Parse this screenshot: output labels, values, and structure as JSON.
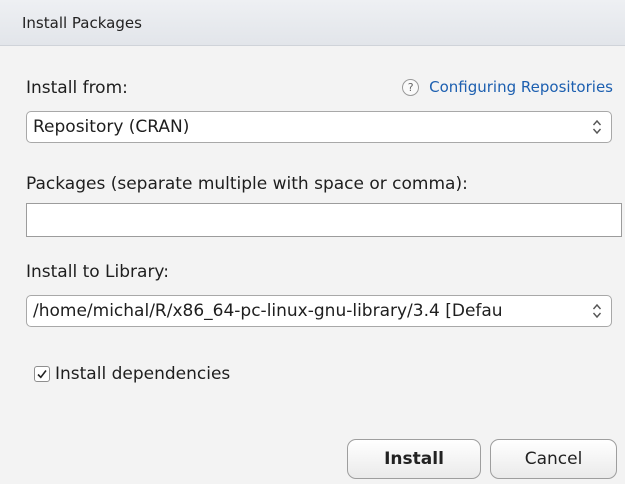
{
  "dialog": {
    "title": "Install Packages"
  },
  "install_from": {
    "label": "Install from:",
    "help_link": "Configuring Repositories",
    "help_icon": "?",
    "selected": "Repository (CRAN)"
  },
  "packages": {
    "label": "Packages (separate multiple with space or comma):",
    "value": ""
  },
  "library": {
    "label": "Install to Library:",
    "selected": "/home/michal/R/x86_64-pc-linux-gnu-library/3.4 [Defau"
  },
  "dependencies": {
    "label": "Install dependencies",
    "checked": true
  },
  "buttons": {
    "install": "Install",
    "cancel": "Cancel"
  }
}
